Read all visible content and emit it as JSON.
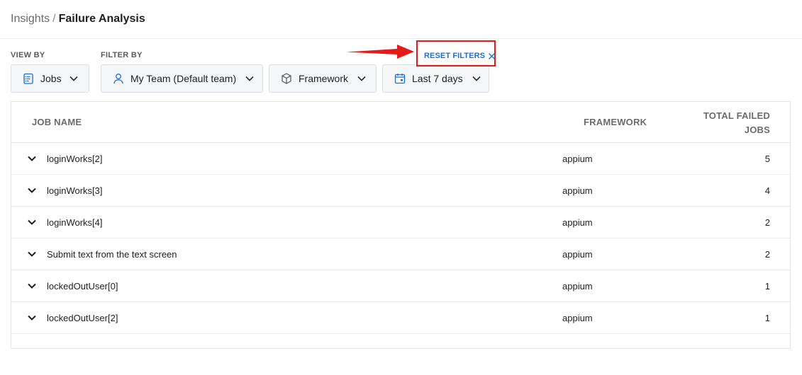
{
  "breadcrumb": {
    "parent": "Insights",
    "separator": "/",
    "current": "Failure Analysis"
  },
  "filters": {
    "view_by_label": "VIEW BY",
    "filter_by_label": "FILTER BY",
    "view_by": {
      "value": "Jobs",
      "icon": "clipboard-list-icon"
    },
    "team": {
      "value": "My Team (Default team)",
      "icon": "user-icon"
    },
    "framework": {
      "value": "Framework",
      "icon": "cube-icon"
    },
    "date_range": {
      "value": "Last 7 days",
      "icon": "calendar-icon"
    },
    "reset_label": "RESET FILTERS"
  },
  "annotation": {
    "highlight_color": "#e31b1b",
    "arrow_color": "#e31b1b"
  },
  "colors": {
    "accent": "#1a6fd8"
  },
  "table": {
    "headers": {
      "job_name": "JOB NAME",
      "framework": "FRAMEWORK",
      "total_failed_line1": "TOTAL FAILED",
      "total_failed_line2": "JOBS"
    },
    "rows": [
      {
        "name": "loginWorks[2]",
        "framework": "appium",
        "count": "5"
      },
      {
        "name": "loginWorks[3]",
        "framework": "appium",
        "count": "4"
      },
      {
        "name": "loginWorks[4]",
        "framework": "appium",
        "count": "2"
      },
      {
        "name": "Submit text from the text screen",
        "framework": "appium",
        "count": "2"
      },
      {
        "name": "lockedOutUser[0]",
        "framework": "appium",
        "count": "1"
      },
      {
        "name": "lockedOutUser[2]",
        "framework": "appium",
        "count": "1"
      }
    ]
  }
}
